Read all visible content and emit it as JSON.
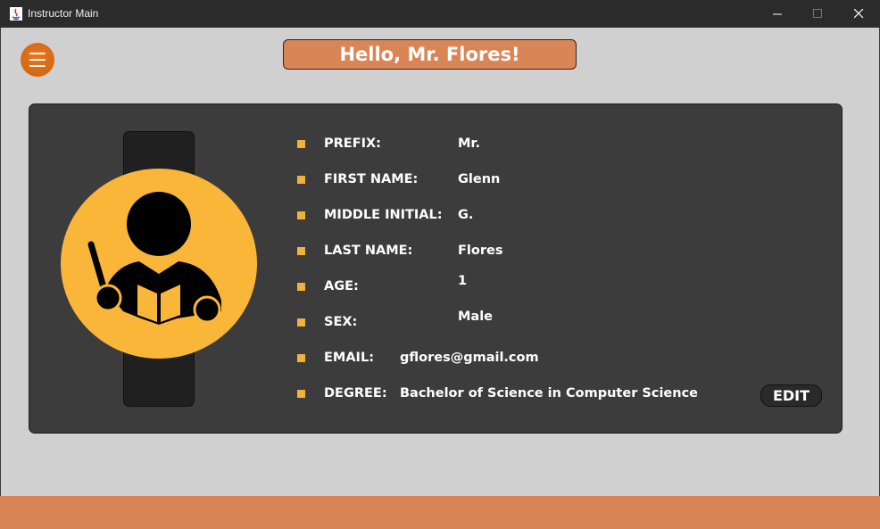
{
  "window": {
    "title": "Instructor Main"
  },
  "header": {
    "greeting": "Hello, Mr. Flores!"
  },
  "profile": {
    "prefix": {
      "label": "PREFIX:",
      "value": "Mr."
    },
    "first_name": {
      "label": "FIRST NAME:",
      "value": "Glenn"
    },
    "middle_initial": {
      "label": "MIDDLE INITIAL:",
      "value": "G."
    },
    "last_name": {
      "label": "LAST NAME:",
      "value": "Flores"
    },
    "age": {
      "label": "AGE:",
      "value": "1"
    },
    "sex": {
      "label": "SEX:",
      "value": "Male"
    },
    "email": {
      "label": "EMAIL:",
      "value": "gflores@gmail.com"
    },
    "degree": {
      "label": "DEGREE:",
      "value": "Bachelor of Science in Computer Science"
    }
  },
  "actions": {
    "edit_label": "EDIT"
  },
  "icons": {
    "menu": "hamburger-menu-icon",
    "avatar": "instructor-avatar-icon",
    "app": "java-icon"
  },
  "colors": {
    "accent": "#d98555",
    "menu_button": "#d66812",
    "avatar_bg": "#f9b638",
    "bullet": "#f2b13a",
    "card_bg": "#3c3c3c",
    "page_bg": "#d0d0d0"
  }
}
